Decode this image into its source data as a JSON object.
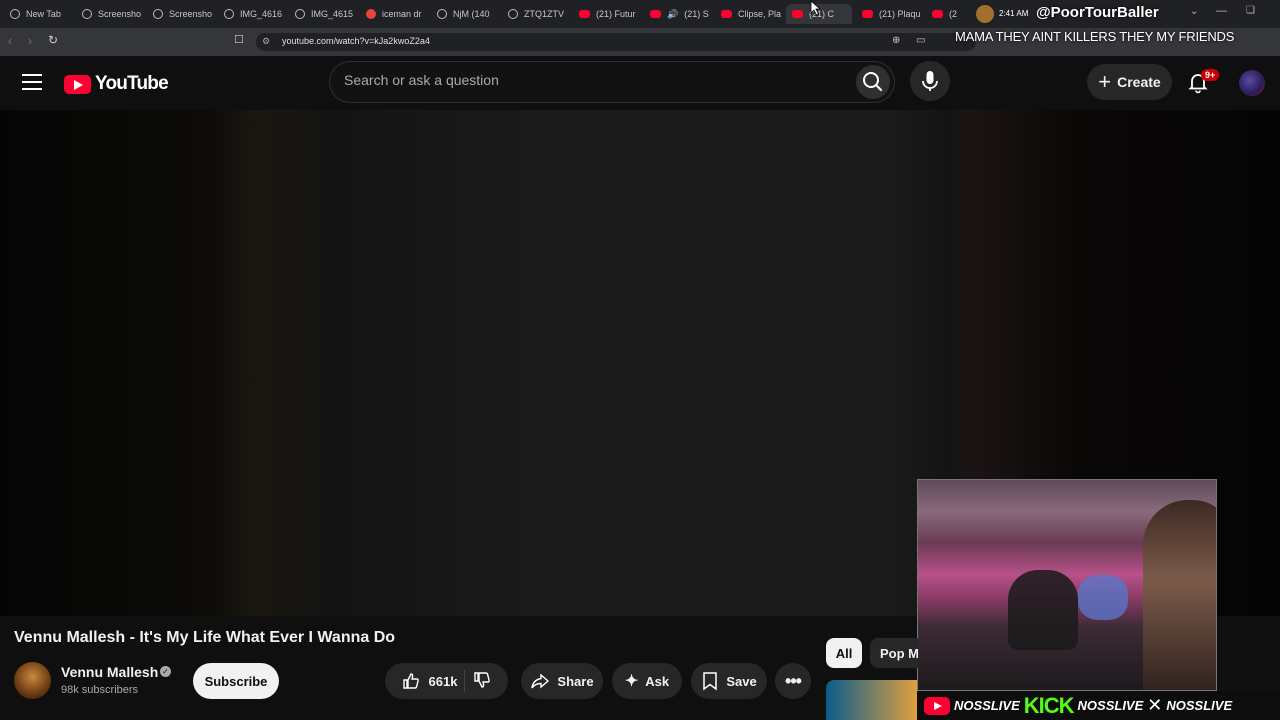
{
  "browser": {
    "tabs": [
      {
        "label": "New Tab",
        "icon": "globe-icon"
      },
      {
        "label": "Screensho",
        "icon": "globe-icon"
      },
      {
        "label": "Screensho",
        "icon": "globe-icon"
      },
      {
        "label": "IMG_4616",
        "icon": "globe-icon"
      },
      {
        "label": "IMG_4615",
        "icon": "globe-icon"
      },
      {
        "label": "iceman dr",
        "icon": "red-circle-icon"
      },
      {
        "label": "NjM (140",
        "icon": "globe-icon"
      },
      {
        "label": "ZTQ1ZTV",
        "icon": "globe-icon"
      },
      {
        "label": "(21) Futur",
        "icon": "youtube-icon"
      },
      {
        "label": "(21) S",
        "icon": "youtube-icon"
      },
      {
        "label": "Clipse, Pla",
        "icon": "youtube-icon"
      },
      {
        "label": "(21) C",
        "icon": "youtube-icon",
        "active": true
      },
      {
        "label": "(21) Plaqu",
        "icon": "youtube-icon"
      },
      {
        "label": "(2",
        "icon": "youtube-icon"
      }
    ],
    "url": "youtube.com/watch?v=kJa2kwoZ2a4"
  },
  "stream_overlay": {
    "time": "2:41 AM",
    "handle": "@PoorTourBaller",
    "lyric": "MAMA THEY AINT KILLERS THEY MY FRIENDS",
    "banner": {
      "yt_name": "NOSSLIVE",
      "kick_logo": "KICK",
      "kick_name": "NOSSLIVE",
      "x_name": "NOSSLIVE"
    }
  },
  "youtube": {
    "logo_text": "YouTube",
    "search_placeholder": "Search or ask a question",
    "create_label": "Create",
    "notif_badge": "9+",
    "video": {
      "title": "Vennu Mallesh - It's My Life What Ever I Wanna Do",
      "channel": "Vennu Mallesh",
      "subscribers": "98k subscribers",
      "subscribe_label": "Subscribe",
      "likes": "661k",
      "share_label": "Share",
      "ask_label": "Ask",
      "save_label": "Save"
    },
    "chips": [
      "All",
      "Pop M"
    ]
  },
  "colors": {
    "brand_red": "#ff0033",
    "kick_green": "#53fc18",
    "background": "#0f0f0f"
  }
}
